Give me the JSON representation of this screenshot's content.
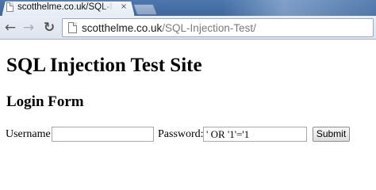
{
  "browser": {
    "tab": {
      "title": "scotthelme.co.uk/SQL-Injection-Test/",
      "close_glyph": "×"
    },
    "nav": {
      "back_icon": "←",
      "forward_icon": "→",
      "reload_icon": "↻"
    },
    "address": {
      "host": "scotthelme.co.uk",
      "path": "/SQL-Injection-Test/"
    }
  },
  "page": {
    "title": "SQL Injection Test Site",
    "form": {
      "heading": "Login Form",
      "username_label": "Username:",
      "username_value": "",
      "password_label": "Password:",
      "password_value": "' OR '1'='1",
      "submit_label": "Submit"
    }
  }
}
